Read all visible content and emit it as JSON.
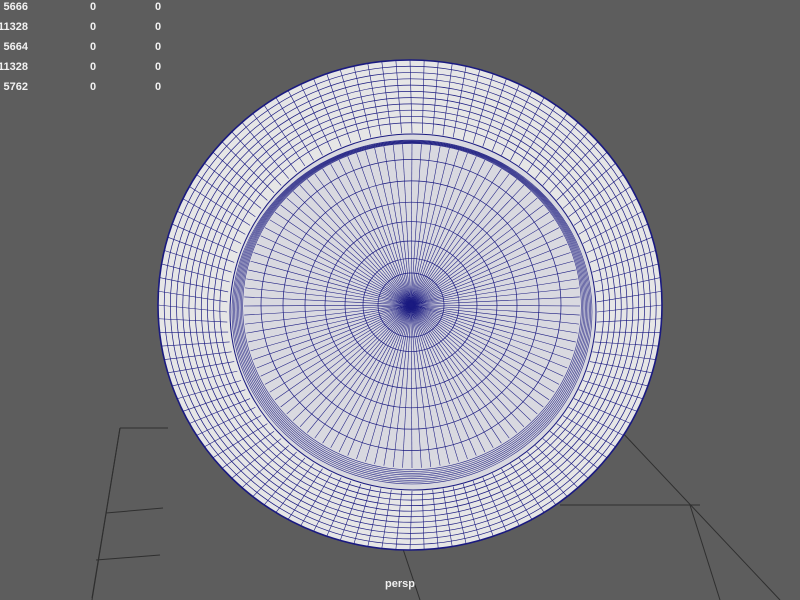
{
  "viewport": {
    "camera_name": "persp",
    "background_color": "#5d5d5d",
    "wire_color": "#1a1a80",
    "surface_color": "#e6e6e6",
    "grid_color": "#2f2f2f"
  },
  "hud": {
    "rows": [
      {
        "values": [
          "5666",
          "0",
          "0"
        ]
      },
      {
        "values": [
          "11328",
          "0",
          "0"
        ]
      },
      {
        "values": [
          "5664",
          "0",
          "0"
        ]
      },
      {
        "values": [
          "11328",
          "0",
          "0"
        ]
      },
      {
        "values": [
          "5762",
          "0",
          "0"
        ]
      }
    ]
  }
}
